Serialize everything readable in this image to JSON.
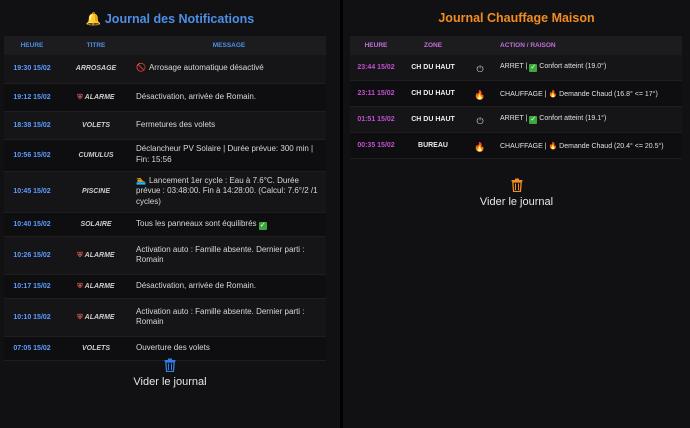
{
  "notifications": {
    "title": "Journal des Notifications",
    "title_icon": "bell-icon",
    "headers": {
      "heure": "HEURE",
      "titre": "TITRE",
      "message": "MESSAGE"
    },
    "rows": [
      {
        "time": "19:30 15/02",
        "titre": "ARROSAGE",
        "icon": "no-entry-icon",
        "message": "Arrosage automatique désactivé"
      },
      {
        "time": "19:12 15/02",
        "titre": "ALARME",
        "icon": "shield-icon",
        "message": "Désactivation, arrivée de Romain."
      },
      {
        "time": "18:38 15/02",
        "titre": "VOLETS",
        "icon": "",
        "message": "Fermetures des volets"
      },
      {
        "time": "10:56 15/02",
        "titre": "CUMULUS",
        "icon": "",
        "message": "Déclancheur PV Solaire | Durée prévue: 300 min | Fin: 15:56"
      },
      {
        "time": "10:45 15/02",
        "titre": "PISCINE",
        "icon": "swimmer-icon",
        "message": "Lancement 1er cycle : Eau à 7.6°C. Durée prévue : 03:48:00. Fin à 14:28:00. (Calcul: 7.6°/2 /1 cycles)"
      },
      {
        "time": "10:40 15/02",
        "titre": "SOLAIRE",
        "icon": "",
        "message": "Tous les panneaux sont équilibrés",
        "suffix_icon": "check-icon"
      },
      {
        "time": "10:26 15/02",
        "titre": "ALARME",
        "icon": "shield-icon",
        "message": "Activation auto : Famille absente. Dernier parti : Romain"
      },
      {
        "time": "10:17 15/02",
        "titre": "ALARME",
        "icon": "shield-icon",
        "message": "Désactivation, arrivée de Romain."
      },
      {
        "time": "10:10 15/02",
        "titre": "ALARME",
        "icon": "shield-icon",
        "message": "Activation auto : Famille absente. Dernier parti : Romain"
      },
      {
        "time": "07:05 15/02",
        "titre": "VOLETS",
        "icon": "",
        "message": "Ouverture des volets"
      }
    ],
    "clear_label": "Vider le journal"
  },
  "chauffage": {
    "title": "Journal Chauffage Maison",
    "headers": {
      "heure": "HEURE",
      "zone": "ZONE",
      "action": "ACTION / RAISON"
    },
    "rows": [
      {
        "time": "23:44 15/02",
        "zone": "CH DU HAUT",
        "icon": "power-icon",
        "action": "ARRET |",
        "action_icon": "check-icon",
        "reason": "Confort atteint (19.0°)"
      },
      {
        "time": "23:11 15/02",
        "zone": "CH DU HAUT",
        "icon": "flame-icon",
        "action": "CHAUFFAGE |",
        "action_icon": "flame-icon",
        "reason": "Demande Chaud (16.8° <= 17°)"
      },
      {
        "time": "01:51 15/02",
        "zone": "CH DU HAUT",
        "icon": "power-icon",
        "action": "ARRET |",
        "action_icon": "check-icon",
        "reason": "Confort atteint (19.1°)"
      },
      {
        "time": "00:35 15/02",
        "zone": "BUREAU",
        "icon": "flame-icon",
        "action": "CHAUFFAGE |",
        "action_icon": "flame-icon",
        "reason": "Demande Chaud (20.4° <= 20.5°)"
      }
    ],
    "clear_label": "Vider le journal"
  },
  "colors": {
    "notif_accent": "#4d8fe6",
    "chauffage_accent": "#f28c1e",
    "chauffage_time": "#c24fcf",
    "trash": "#2f7fe8",
    "trash_orange": "#f28c1e"
  }
}
